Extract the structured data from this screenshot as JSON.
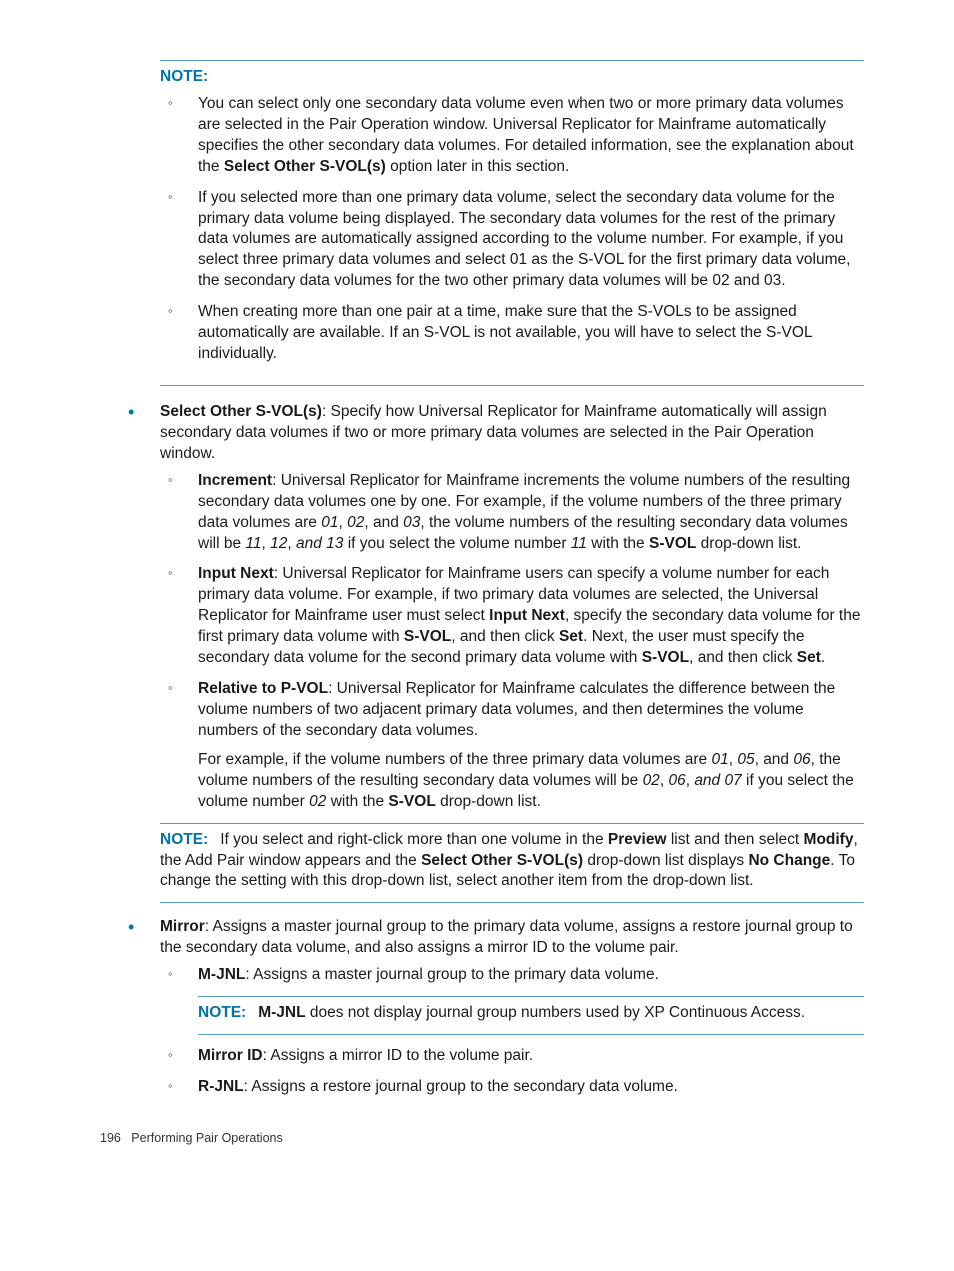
{
  "note1": {
    "heading": "NOTE:",
    "items": [
      {
        "pre": "You can select only one secondary data volume even when two or more primary data volumes are selected in the Pair Operation window. Universal Replicator for Mainframe automatically specifies the other secondary data volumes. For detailed information, see the explanation about the ",
        "b": "Select Other S-VOL(s)",
        "post": " option later in this section."
      },
      {
        "text": "If you selected more than one primary data volume, select the secondary data volume for the primary data volume being displayed. The secondary data volumes for the rest of the primary data volumes are automatically assigned according to the volume number. For example, if you select three primary data volumes and select 01 as the S-VOL for the first primary data volume, the secondary data volumes for the two other primary data volumes will be 02 and 03."
      },
      {
        "text": "When creating more than one pair at a time, make sure that the S-VOLs to be assigned automatically are available. If an S-VOL is not available, you will have to select the S-VOL individually."
      }
    ]
  },
  "selectOther": {
    "label": "Select Other S-VOL(s)",
    "desc": ": Specify how Universal Replicator for Mainframe automatically will assign secondary data volumes if two or more primary data volumes are selected in the Pair Operation window.",
    "sub": [
      {
        "label": "Increment",
        "t1": ": Universal Replicator for Mainframe increments the volume numbers of the resulting secondary data volumes one by one. For example, if the volume numbers of the three primary data volumes are ",
        "i1": "01",
        "m1": ", ",
        "i2": "02",
        "m2": ", and ",
        "i3": "03",
        "t2": ", the volume numbers of the resulting secondary data volumes will be ",
        "i4": "11",
        "m3": ", ",
        "i5": "12",
        "m4": ", ",
        "i6": "and 13",
        "t3": " if you select the volume number ",
        "i7": "11",
        "t4": " with the ",
        "b1": "S-VOL",
        "t5": " drop-down list."
      },
      {
        "label": "Input Next",
        "t1": ": Universal Replicator for Mainframe users can specify a volume number for each primary data volume. For example, if two primary data volumes are selected, the Universal Replicator for Mainframe user must select ",
        "b1": "Input Next",
        "t2": ", specify the secondary data volume for the first primary data volume with ",
        "b2": "S-VOL",
        "t3": ", and then click ",
        "b3": "Set",
        "t4": ". Next, the user must specify the secondary data volume for the second primary data volume with ",
        "b4": "S-VOL",
        "t5": ", and then click ",
        "b5": "Set",
        "t6": "."
      },
      {
        "label": "Relative to P-VOL",
        "t1": ": Universal Replicator for Mainframe calculates the difference between the volume numbers of two adjacent primary data volumes, and then determines the volume numbers of the secondary data volumes.",
        "p2a": "For example, if the volume numbers of the three primary data volumes are ",
        "i1": "01",
        "m1": ", ",
        "i2": "05",
        "m2": ", and ",
        "i3": "06",
        "p2b": ", the volume numbers of the resulting secondary data volumes will be ",
        "i4": "02",
        "m3": ", ",
        "i5": "06",
        "m4": ", ",
        "i6": "and 07",
        "p2c": " if you select the volume number ",
        "i7": "02",
        "p2d": " with the ",
        "b1": "S-VOL",
        "p2e": " drop-down list."
      }
    ]
  },
  "note2": {
    "label": "NOTE:",
    "t1": "If you select and right-click more than one volume in the ",
    "b1": "Preview",
    "t2": " list and then select ",
    "b2": "Modify",
    "t3": ", the Add Pair window appears and the ",
    "b3": "Select Other S-VOL(s)",
    "t4": " drop-down list displays ",
    "b4": "No Change",
    "t5": ". To change the setting with this drop-down list, select another item from the drop-down list."
  },
  "mirror": {
    "label": "Mirror",
    "desc": ": Assigns a master journal group to the primary data volume, assigns a restore journal group to the secondary data volume, and also assigns a mirror ID to the volume pair.",
    "sub": [
      {
        "label": "M-JNL",
        "desc": ": Assigns a master journal group to the primary data volume."
      },
      {
        "label": "Mirror ID",
        "desc": ": Assigns a mirror ID to the volume pair."
      },
      {
        "label": "R-JNL",
        "desc": ": Assigns a restore journal group to the secondary data volume."
      }
    ],
    "note": {
      "label": "NOTE:",
      "b": "M-JNL",
      "t": " does not display journal group numbers used by XP Continuous Access."
    }
  },
  "footer": {
    "page": "196",
    "title": "Performing Pair Operations"
  }
}
